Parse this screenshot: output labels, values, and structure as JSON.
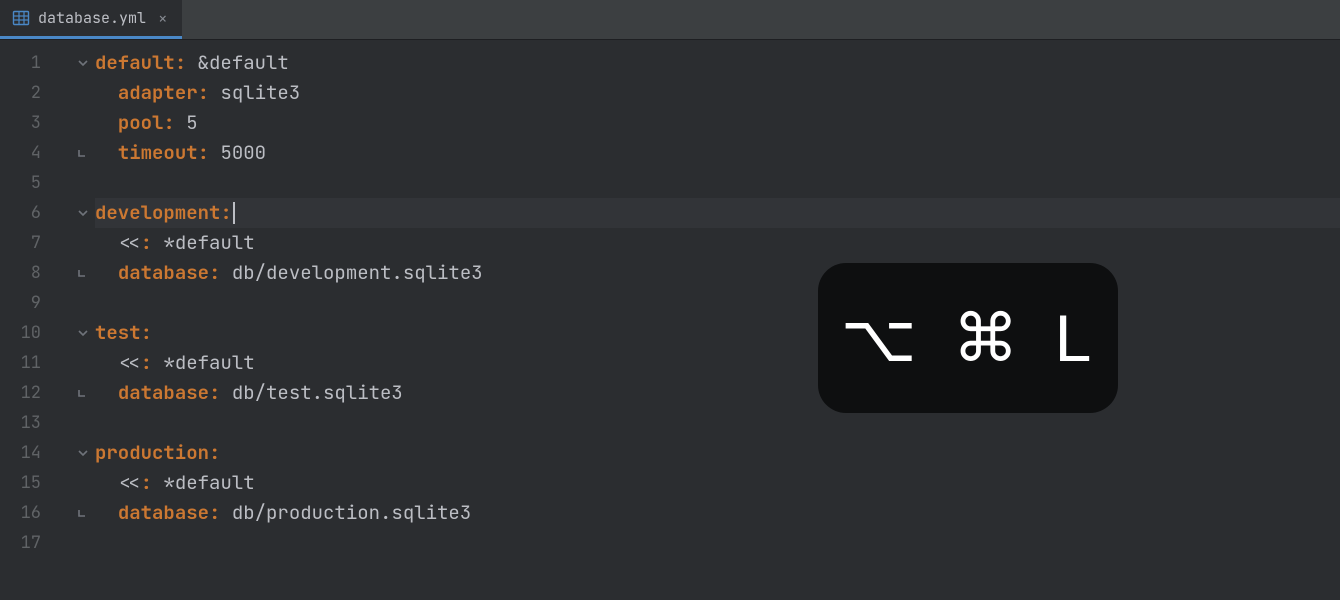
{
  "tab": {
    "filename": "database.yml",
    "close_glyph": "×"
  },
  "shortcut": {
    "keys": [
      "⌥",
      "⌘",
      "L"
    ]
  },
  "gutter": {
    "lines": [
      "1",
      "2",
      "3",
      "4",
      "5",
      "6",
      "7",
      "8",
      "9",
      "10",
      "11",
      "12",
      "13",
      "14",
      "15",
      "16",
      "17"
    ]
  },
  "code": {
    "current_line_index": 5,
    "lines": [
      {
        "indent": 0,
        "fold": "open",
        "tokens": [
          [
            "k",
            "default"
          ],
          [
            "col",
            ":"
          ],
          [
            "s",
            " "
          ],
          [
            "op",
            "&default"
          ]
        ]
      },
      {
        "indent": 1,
        "fold": "",
        "tokens": [
          [
            "k",
            "adapter"
          ],
          [
            "col",
            ":"
          ],
          [
            "s",
            " sqlite3"
          ]
        ]
      },
      {
        "indent": 1,
        "fold": "",
        "tokens": [
          [
            "k",
            "pool"
          ],
          [
            "col",
            ":"
          ],
          [
            "s",
            " "
          ],
          [
            "num",
            "5"
          ]
        ]
      },
      {
        "indent": 1,
        "fold": "close",
        "tokens": [
          [
            "k",
            "timeout"
          ],
          [
            "col",
            ":"
          ],
          [
            "s",
            " "
          ],
          [
            "num",
            "5000"
          ]
        ]
      },
      {
        "indent": 0,
        "fold": "",
        "tokens": []
      },
      {
        "indent": 0,
        "fold": "open",
        "tokens": [
          [
            "k",
            "development"
          ],
          [
            "col",
            ":"
          ]
        ],
        "caret": true
      },
      {
        "indent": 1,
        "fold": "",
        "tokens": [
          [
            "op",
            "<<"
          ],
          [
            "col",
            ":"
          ],
          [
            "s",
            " "
          ],
          [
            "op",
            "*default"
          ]
        ]
      },
      {
        "indent": 1,
        "fold": "close",
        "tokens": [
          [
            "k",
            "database"
          ],
          [
            "col",
            ":"
          ],
          [
            "s",
            " db/development.sqlite3"
          ]
        ]
      },
      {
        "indent": 0,
        "fold": "",
        "tokens": []
      },
      {
        "indent": 0,
        "fold": "open",
        "tokens": [
          [
            "k",
            "test"
          ],
          [
            "col",
            ":"
          ]
        ]
      },
      {
        "indent": 1,
        "fold": "",
        "tokens": [
          [
            "op",
            "<<"
          ],
          [
            "col",
            ":"
          ],
          [
            "s",
            " "
          ],
          [
            "op",
            "*default"
          ]
        ]
      },
      {
        "indent": 1,
        "fold": "close",
        "tokens": [
          [
            "k",
            "database"
          ],
          [
            "col",
            ":"
          ],
          [
            "s",
            " db/test.sqlite3"
          ]
        ]
      },
      {
        "indent": 0,
        "fold": "",
        "tokens": []
      },
      {
        "indent": 0,
        "fold": "open",
        "tokens": [
          [
            "k",
            "production"
          ],
          [
            "col",
            ":"
          ]
        ]
      },
      {
        "indent": 1,
        "fold": "",
        "tokens": [
          [
            "op",
            "<<"
          ],
          [
            "col",
            ":"
          ],
          [
            "s",
            " "
          ],
          [
            "op",
            "*default"
          ]
        ]
      },
      {
        "indent": 1,
        "fold": "close",
        "tokens": [
          [
            "k",
            "database"
          ],
          [
            "col",
            ":"
          ],
          [
            "s",
            " db/production.sqlite3"
          ]
        ]
      },
      {
        "indent": 0,
        "fold": "",
        "tokens": []
      }
    ]
  }
}
